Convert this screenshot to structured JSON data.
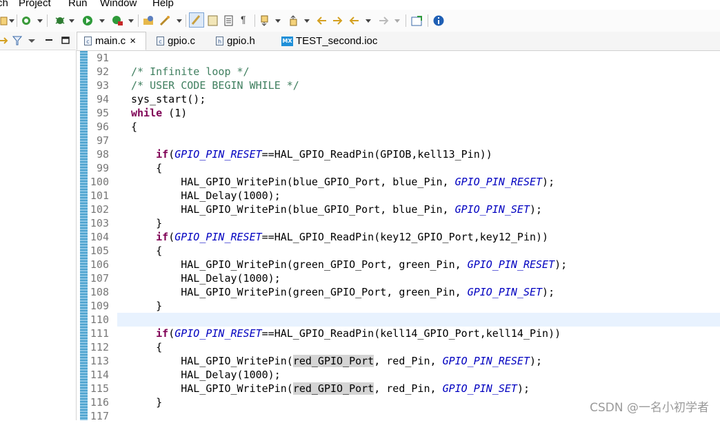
{
  "menu": [
    "ch",
    "Project",
    "Run",
    "Window",
    "Help"
  ],
  "tabs": [
    {
      "label": "main.c",
      "icon": "c-file-icon",
      "active": true,
      "close": "×"
    },
    {
      "label": "gpio.c",
      "icon": "c-file-icon",
      "active": false
    },
    {
      "label": "gpio.h",
      "icon": "h-file-icon",
      "active": false
    },
    {
      "label": "TEST_second.ioc",
      "icon": "mx-file-icon",
      "badge": "MX",
      "active": false
    }
  ],
  "editor": {
    "current_line": "110",
    "lines": [
      {
        "n": "91",
        "t": ""
      },
      {
        "n": "92",
        "t": "/* Infinite loop */"
      },
      {
        "n": "93",
        "t": "/* USER CODE BEGIN WHILE */"
      },
      {
        "n": "94",
        "t": "sys_start();"
      },
      {
        "n": "95",
        "t": "while (1)"
      },
      {
        "n": "96",
        "t": "{"
      },
      {
        "n": "97",
        "t": ""
      },
      {
        "n": "98",
        "t": "    if(GPIO_PIN_RESET==HAL_GPIO_ReadPin(GPIOB,kell13_Pin))"
      },
      {
        "n": "99",
        "t": "    {"
      },
      {
        "n": "100",
        "t": "        HAL_GPIO_WritePin(blue_GPIO_Port, blue_Pin, GPIO_PIN_RESET);"
      },
      {
        "n": "101",
        "t": "        HAL_Delay(1000);"
      },
      {
        "n": "102",
        "t": "        HAL_GPIO_WritePin(blue_GPIO_Port, blue_Pin, GPIO_PIN_SET);"
      },
      {
        "n": "103",
        "t": "    }"
      },
      {
        "n": "104",
        "t": "    if(GPIO_PIN_RESET==HAL_GPIO_ReadPin(key12_GPIO_Port,key12_Pin))"
      },
      {
        "n": "105",
        "t": "    {"
      },
      {
        "n": "106",
        "t": "        HAL_GPIO_WritePin(green_GPIO_Port, green_Pin, GPIO_PIN_RESET);"
      },
      {
        "n": "107",
        "t": "        HAL_Delay(1000);"
      },
      {
        "n": "108",
        "t": "        HAL_GPIO_WritePin(green_GPIO_Port, green_Pin, GPIO_PIN_SET);"
      },
      {
        "n": "109",
        "t": "    }"
      },
      {
        "n": "110",
        "t": ""
      },
      {
        "n": "111",
        "t": "    if(GPIO_PIN_RESET==HAL_GPIO_ReadPin(kell14_GPIO_Port,kell14_Pin))"
      },
      {
        "n": "112",
        "t": "    {"
      },
      {
        "n": "113",
        "t": "        HAL_GPIO_WritePin(red_GPIO_Port, red_Pin, GPIO_PIN_RESET);"
      },
      {
        "n": "114",
        "t": "        HAL_Delay(1000);"
      },
      {
        "n": "115",
        "t": "        HAL_GPIO_WritePin(red_GPIO_Port, red_Pin, GPIO_PIN_SET);"
      },
      {
        "n": "116",
        "t": "    }"
      },
      {
        "n": "117",
        "t": ""
      }
    ],
    "keywords": [
      "if",
      "while"
    ],
    "macros": [
      "GPIO_PIN_RESET",
      "GPIO_PIN_SET"
    ],
    "highlighted": "red_GPIO_Port"
  },
  "watermark": "CSDN @一名小初学者",
  "colors": {
    "keyword": "#7f0055",
    "macro": "#0000c0",
    "comment": "#3f7f5f",
    "current_line": "#e8f2fe",
    "gutter": "#4da3cf"
  }
}
